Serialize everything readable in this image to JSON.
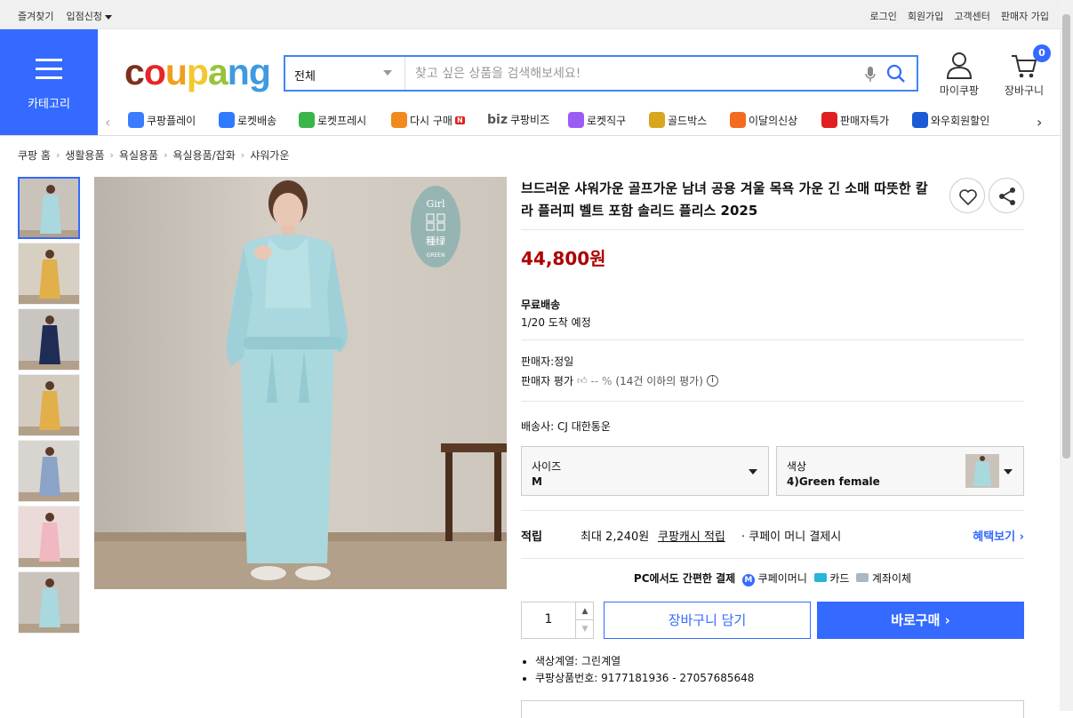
{
  "topbar": {
    "left": [
      "즐겨찾기",
      "입점신청"
    ],
    "right": [
      "로그인",
      "회원가입",
      "고객센터",
      "판매자 가입"
    ]
  },
  "category_label": "카테고리",
  "logo": {
    "letters": [
      "c",
      "o",
      "u",
      "p",
      "a",
      "n",
      "g"
    ],
    "colors": [
      "#7f2f1c",
      "#e52628",
      "#ef9e1d",
      "#f2c82d",
      "#97c43a",
      "#3f9ae0",
      "#3f9ae0"
    ]
  },
  "search": {
    "scope": "전체",
    "placeholder": "찾고 싶은 상품을 검색해보세요!"
  },
  "header": {
    "mypage": "마이쿠팡",
    "cart": "장바구니",
    "cart_count": "0"
  },
  "service_nav": [
    {
      "label": "쿠팡플레이",
      "icon": "play-icon",
      "color": "#3b7cff"
    },
    {
      "label": "로켓배송",
      "icon": "rocket-icon",
      "color": "#2e7bff"
    },
    {
      "label": "로켓프레시",
      "icon": "rocket-fresh-icon",
      "color": "#3ab54a"
    },
    {
      "label": "다시 구매",
      "icon": "rebuy-icon",
      "color": "#f08a1c",
      "badge": "N"
    },
    {
      "label": "쿠팡비즈",
      "icon": "biz-icon",
      "prefix": "biz"
    },
    {
      "label": "로켓직구",
      "icon": "global-icon",
      "color": "#9b5cf6"
    },
    {
      "label": "골드박스",
      "icon": "goldbox-icon",
      "color": "#d9a620"
    },
    {
      "label": "이달의신상",
      "icon": "new-icon",
      "color": "#f36b21"
    },
    {
      "label": "판매자특가",
      "icon": "percent-icon",
      "color": "#e02020"
    },
    {
      "label": "와우회원할인",
      "icon": "wow-icon",
      "color": "#1b5bd6"
    }
  ],
  "breadcrumb": [
    "쿠팡 홈",
    "생활용품",
    "욕실용품",
    "욕실용품/잡화",
    "샤워가운"
  ],
  "colors": {
    "accent": "#346aff",
    "price": "#ae0000"
  },
  "thumbnails": [
    {
      "robe": "#a9d8de",
      "bg": "#c9c3bb"
    },
    {
      "robe": "#e1b04a",
      "bg": "#d8cfc3"
    },
    {
      "robe": "#1f2c55",
      "bg": "#c9c6c2"
    },
    {
      "robe": "#e1b04a",
      "bg": "#d3cbc0"
    },
    {
      "robe": "#8aa3c7",
      "bg": "#d8d4cf"
    },
    {
      "robe": "#f0b8c0",
      "bg": "#ebdbd8"
    },
    {
      "robe": "#a9d8de",
      "bg": "#c9c3bb"
    }
  ],
  "main_image": {
    "tag_top": "Girl",
    "tag_mid": "種绿",
    "tag_bottom": "GREEN"
  },
  "product": {
    "title": "브드러운 샤워가운 골프가운 남녀 공용 겨울 목욕 가운 긴 소매 따뜻한 칼라 플러피 벨트 포함 솔리드 플리스 2025",
    "price": "44,800원",
    "shipping_label": "무료배송",
    "arrival": "1/20 도착 예정",
    "seller": "판매자:정일",
    "rating_label": "판매자 평가",
    "rating_value": "-- %",
    "rating_note": "(14건 이하의 평가)",
    "courier": "배송사:  CJ 대한통운"
  },
  "options": {
    "size_label": "사이즈",
    "size_value": "M",
    "color_label": "색상",
    "color_value": "4)Green female"
  },
  "reward": {
    "label": "적립",
    "amount": "최대 2,240원",
    "link": "쿠팡캐시 적립",
    "rest": "· 쿠페이 머니 결제시",
    "more": "혜택보기"
  },
  "pay": {
    "lead": "PC에서도 간편한 결제",
    "money": "쿠페이머니",
    "card": "카드",
    "bank": "계좌이체"
  },
  "quantity": "1",
  "buttons": {
    "add_cart": "장바구니 담기",
    "buy": "바로구매"
  },
  "details": [
    "색상계열: 그린계열",
    "쿠팡상품번호: 9177181936 - 27057685648"
  ]
}
